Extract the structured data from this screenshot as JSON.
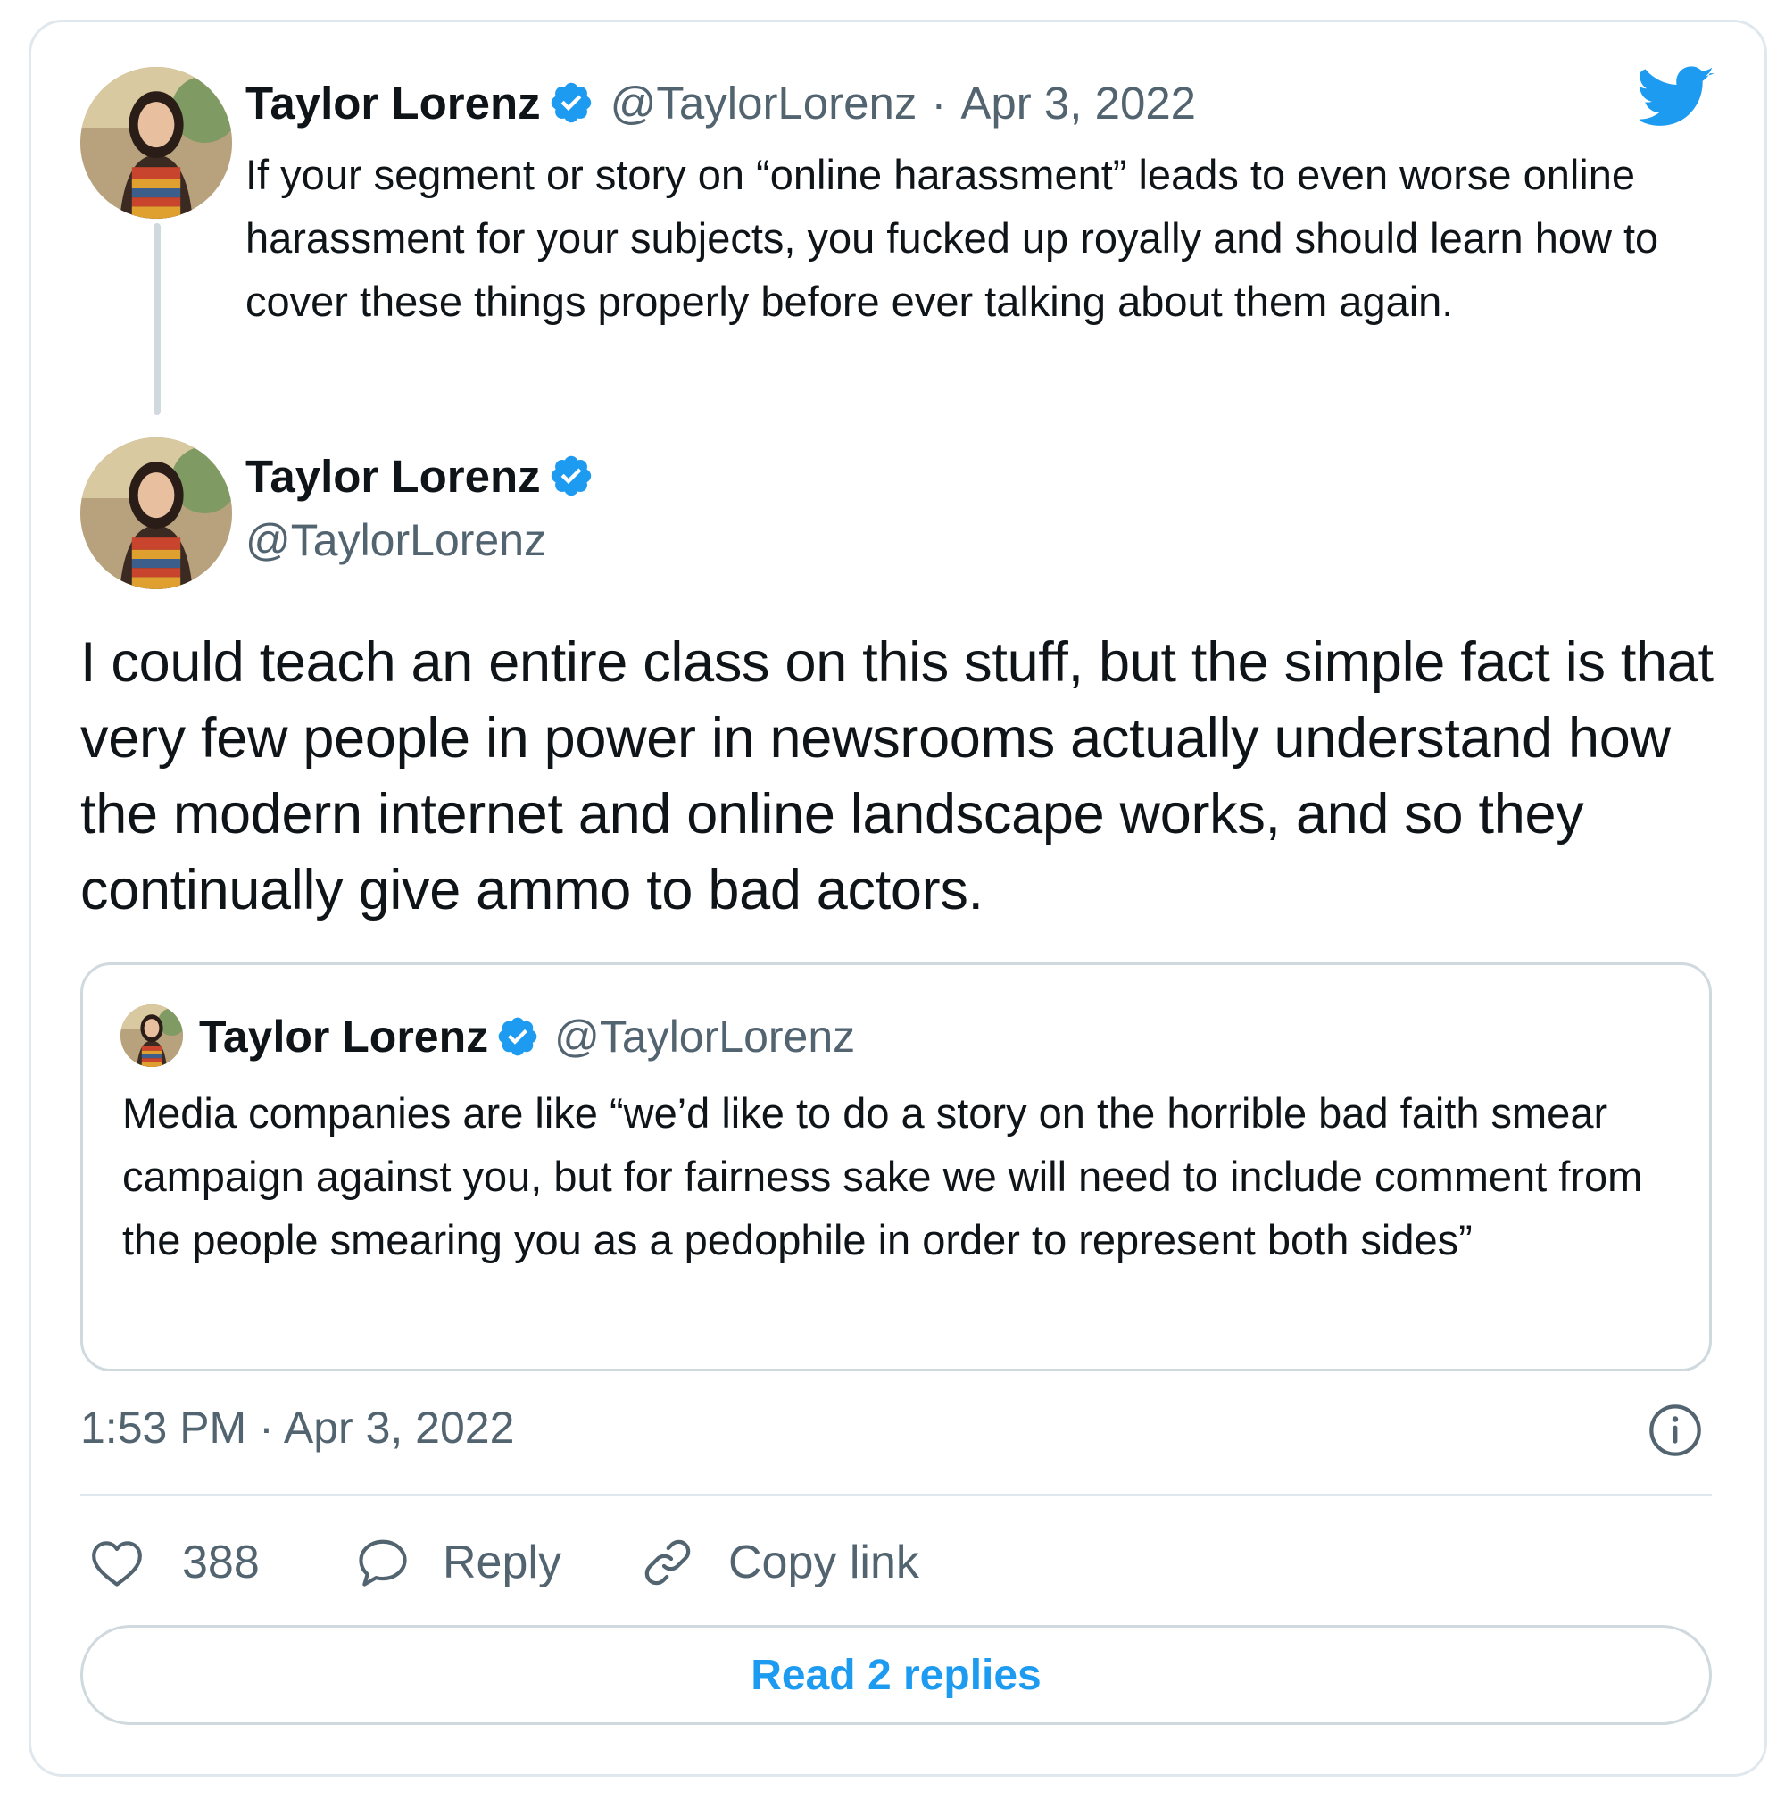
{
  "brand_color": "#1d9bf0",
  "parent_tweet": {
    "author_name": "Taylor Lorenz",
    "handle": "@TaylorLorenz",
    "separator": "·",
    "date": "Apr 3, 2022",
    "text": "If your segment or story on “online harassment” leads to even worse online harassment for your subjects, you fucked up royally and should learn how to cover these things properly before ever talking about them again."
  },
  "main_tweet": {
    "author_name": "Taylor Lorenz",
    "handle": "@TaylorLorenz",
    "text": "I could teach an entire class on this stuff, but the simple fact is that very few people in power in newsrooms actually understand how the modern internet and online landscape works, and so they continually give ammo to bad actors.",
    "timestamp": "1:53 PM · Apr 3, 2022"
  },
  "quoted_tweet": {
    "author_name": "Taylor Lorenz",
    "handle": "@TaylorLorenz",
    "text": "Media companies are like “we’d like to do a story on the horrible bad faith smear campaign against you, but for fairness sake we will need to include comment from the people smearing you as a pedophile in order to represent both sides”"
  },
  "actions": {
    "like_count": "388",
    "reply_label": "Reply",
    "copy_link_label": "Copy link"
  },
  "read_replies_label": "Read 2 replies",
  "icons": [
    "twitter-bird-icon",
    "verified-badge-icon",
    "heart-icon",
    "reply-bubble-icon",
    "link-icon",
    "info-icon"
  ]
}
